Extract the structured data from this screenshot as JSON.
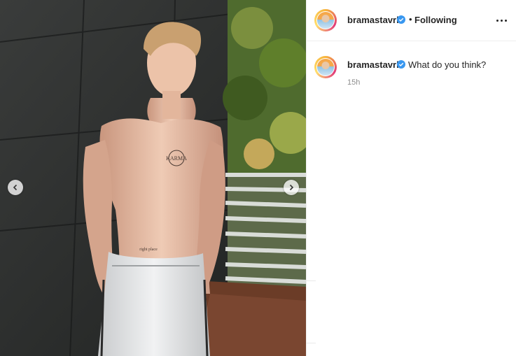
{
  "post": {
    "username": "bramastavrl",
    "follow_status": "Following",
    "separator": "•",
    "more_icon": "more-horizontal-icon",
    "verified_icon": "verified-badge-icon",
    "colors": {
      "verified": "#3897f0",
      "text": "#262626",
      "secondary": "#8e8e8e"
    }
  },
  "comment": {
    "username": "bramastavrl",
    "text": "What do you think?",
    "time": "15h"
  },
  "photo": {
    "tattoo_chest": "KARMA",
    "tattoo_abdomen": "right place",
    "nav_prev_icon": "chevron-left-icon",
    "nav_next_icon": "chevron-right-icon"
  }
}
